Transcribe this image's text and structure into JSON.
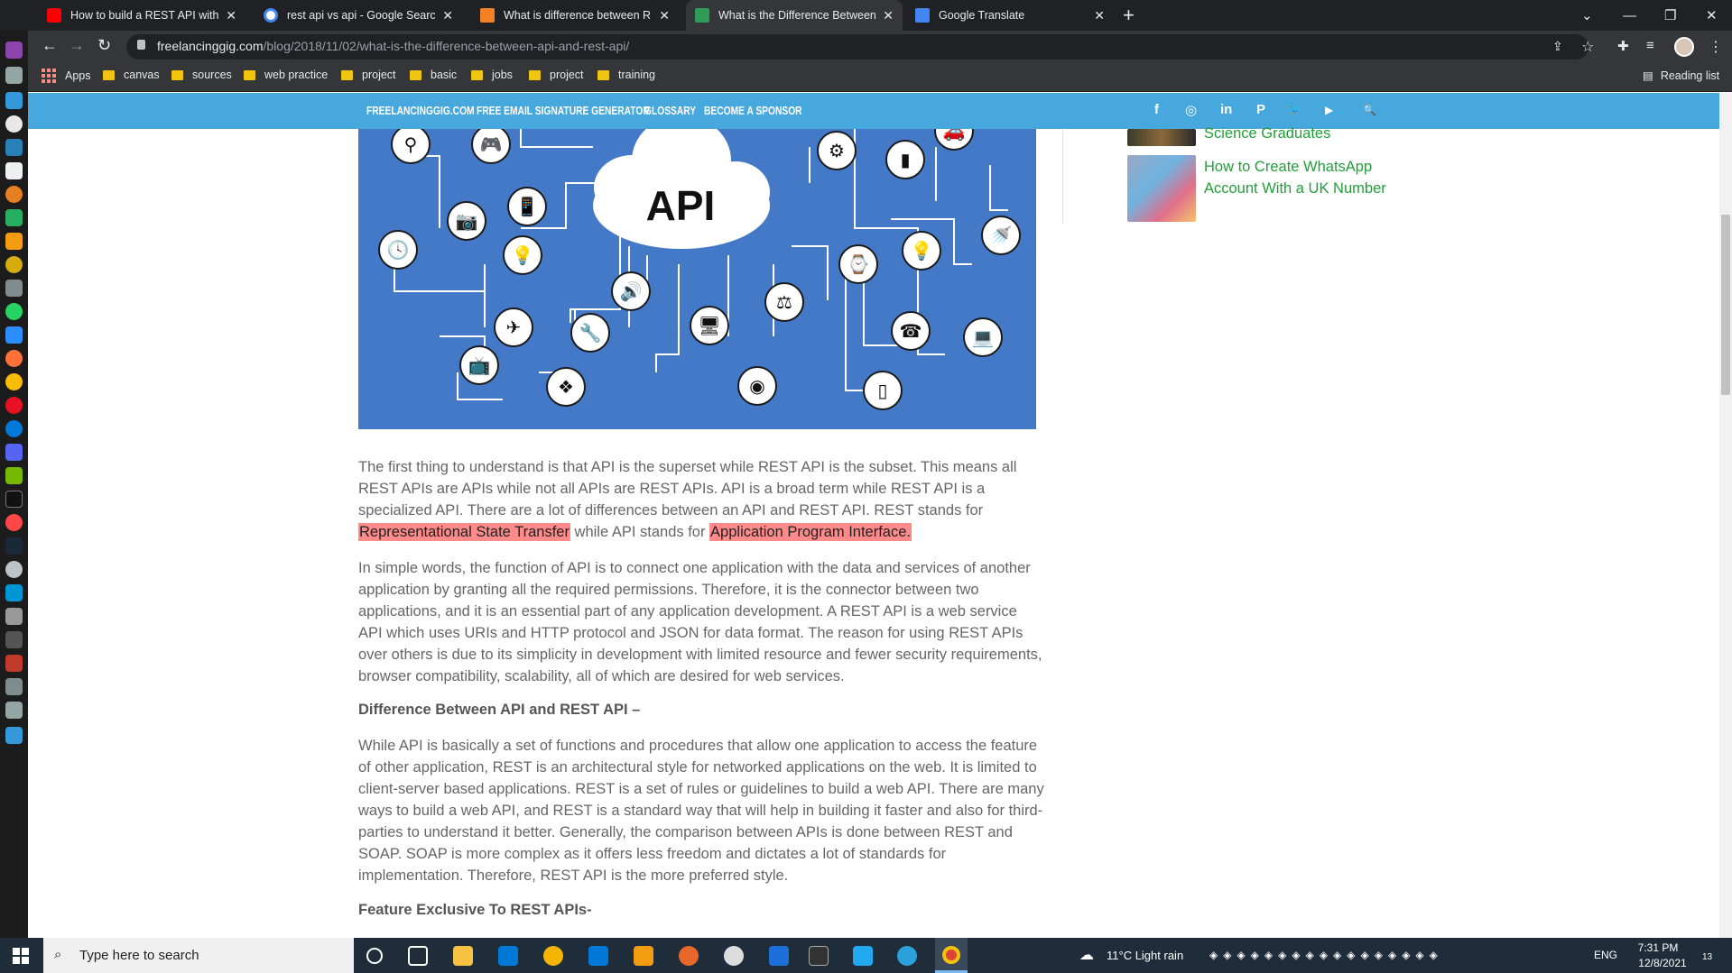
{
  "browser": {
    "tabs": [
      {
        "title": "How to build a REST API with No",
        "fav": "#ff0000"
      },
      {
        "title": "rest api vs api - Google Search",
        "fav": "#4285f4"
      },
      {
        "title": "What is difference between REST",
        "fav": "#f48024"
      },
      {
        "title": "What is the Difference Between A",
        "fav": "#2e9b57"
      },
      {
        "title": "Google Translate",
        "fav": "#4285f4"
      }
    ],
    "url_domain": "freelancinggig.com",
    "url_path": "/blog/2018/11/02/what-is-the-difference-between-api-and-rest-api/",
    "bookmarks": [
      "Apps",
      "canvas",
      "sources",
      "web practice",
      "project",
      "basic",
      "jobs",
      "project",
      "training"
    ],
    "reading_list": "Reading list"
  },
  "site": {
    "nav": [
      "FREELANCINGGIG.COM",
      "FREE EMAIL SIGNATURE GENERATOR",
      "GLOSSARY",
      "BECOME A SPONSOR"
    ],
    "social": [
      "f",
      "◎",
      "in",
      "P",
      "🐦",
      "▶",
      "🔍"
    ]
  },
  "hero": {
    "text": "API"
  },
  "sidebar": {
    "item1": "Science Graduates",
    "item2": "How to Create WhatsApp Account With a UK Number"
  },
  "article": {
    "p1_a": "The first thing to understand is that API is the superset while REST API is the subset. This means all REST APIs are APIs while not all APIs are REST APIs. API is a broad term while REST API is a specialized API. There are a lot of differences between an API and REST API. REST stands for ",
    "p1_hl1": "Representational State Transfer",
    "p1_b": " while API stands for ",
    "p1_hl2": "Application Program Interface.",
    "p2": "In simple words, the function of API is to connect one application with the data and services of another application by granting all the required permissions. Therefore, it is the connector between two applications, and it is an essential part of any application development. A REST API is a web service API which uses URIs and HTTP protocol and JSON for data format. The reason for using REST APIs over others is due to its simplicity in development with limited resource and fewer security requirements, browser compatibility, scalability, all of which are desired for web services.",
    "h1": "Difference Between API and REST API –",
    "p3": "While API is basically a set of functions and procedures that allow one application to access the feature of other application, REST is an architectural style for networked applications on the web. It is limited to client-server based applications. REST is a set of rules or guidelines to build a web API. There are many ways to build a web API, and REST is a standard way that will help in building it faster and also for third-parties to understand it better. Generally, the comparison between APIs is done between REST and SOAP.  SOAP is more complex as it offers less freedom and dictates a lot of standards for implementation. Therefore, REST API is the more preferred style.",
    "h2": "Feature Exclusive To REST APIs-"
  },
  "taskbar": {
    "search_placeholder": "Type here to search",
    "weather": "11°C  Light rain",
    "lang": "ENG",
    "time": "7:31 PM",
    "date": "12/8/2021",
    "notif": "13"
  }
}
